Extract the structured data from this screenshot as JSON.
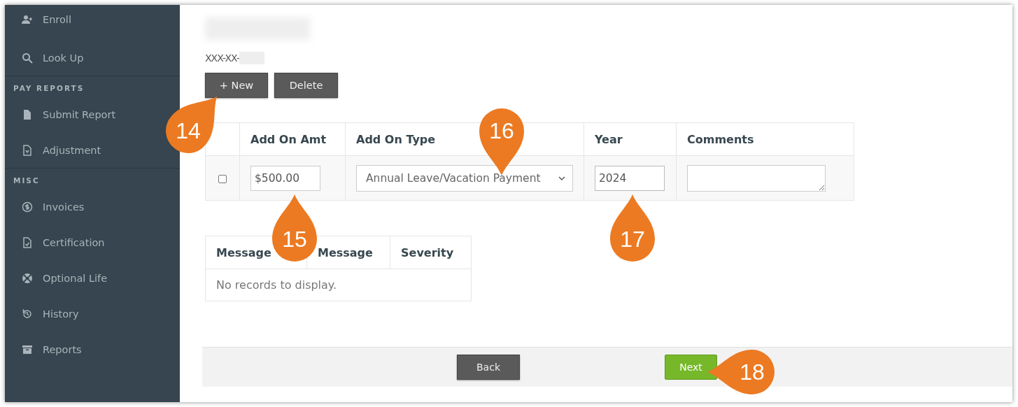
{
  "sidebar": {
    "sections": [
      {
        "items": [
          {
            "label": "Enroll"
          },
          {
            "label": "Look Up"
          }
        ]
      },
      {
        "header": "PAY REPORTS",
        "items": [
          {
            "label": "Submit Report"
          },
          {
            "label": "Adjustment"
          }
        ]
      },
      {
        "header": "MISC",
        "items": [
          {
            "label": "Invoices"
          },
          {
            "label": "Certification"
          },
          {
            "label": "Optional Life"
          },
          {
            "label": "History"
          },
          {
            "label": "Reports"
          }
        ]
      }
    ]
  },
  "member": {
    "ssn": "XXX-XX-"
  },
  "toolbar": {
    "buttons": [
      "+ New",
      "Delete"
    ]
  },
  "add_ons": {
    "columns": [
      "",
      "Add On Amt",
      "Add On Type",
      "Year",
      "Comments"
    ],
    "rows": [
      {
        "checked": false,
        "amount": "$500.00",
        "type": "Annual Leave/Vacation Payment",
        "year": "2024",
        "comments": ""
      }
    ]
  },
  "messages": {
    "columns": [
      "Message",
      "Message",
      "Severity"
    ],
    "empty_text": "No records to display."
  },
  "footer": {
    "back": "Back",
    "next": "Next"
  },
  "callouts": [
    {
      "number": "14"
    },
    {
      "number": "15"
    },
    {
      "number": "16"
    },
    {
      "number": "17"
    },
    {
      "number": "18"
    }
  ]
}
